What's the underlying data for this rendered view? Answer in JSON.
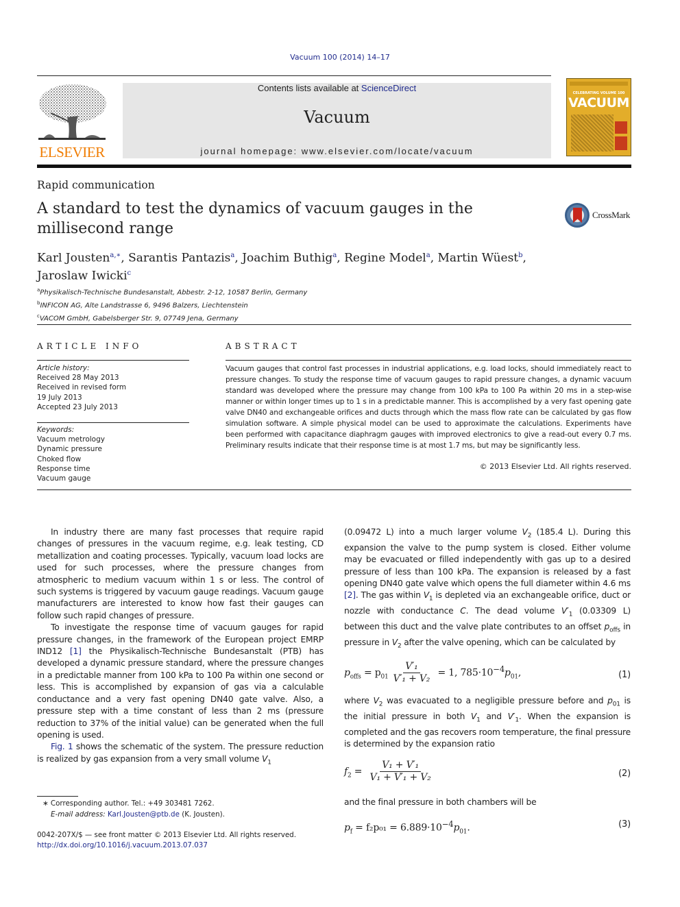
{
  "header": {
    "citation": "Vacuum 100 (2014) 14–17",
    "contents_prefix": "Contents lists available at ",
    "contents_link": "ScienceDirect",
    "journal_name": "Vacuum",
    "homepage_label": "journal homepage: ",
    "homepage_url": "www.elsevier.com/locate/vacuum",
    "publisher_logo": "ELSEVIER",
    "cover": {
      "banner": "CELEBRATING VOLUME 100",
      "title": "VACUUM"
    },
    "colors": {
      "brand_orange": "#f07c00",
      "link_blue": "#1f2a8c",
      "banner_gray": "#e6e6e6",
      "cover_yellow": "#e3ad2a"
    }
  },
  "article": {
    "type": "Rapid communication",
    "title": "A standard to test the dynamics of vacuum gauges in the millisecond range",
    "crossmark_label": "CrossMark",
    "authors": [
      {
        "name": "Karl Jousten",
        "sup": "a,∗"
      },
      {
        "name": "Sarantis Pantazis",
        "sup": "a"
      },
      {
        "name": "Joachim Buthig",
        "sup": "a"
      },
      {
        "name": "Regine Model",
        "sup": "a"
      },
      {
        "name": "Martin Wüest",
        "sup": "b"
      },
      {
        "name": "Jaroslaw Iwicki",
        "sup": "c"
      }
    ],
    "affiliations": [
      {
        "key": "a",
        "text": "Physikalisch-Technische Bundesanstalt, Abbestr. 2-12, 10587 Berlin, Germany"
      },
      {
        "key": "b",
        "text": "INFICON AG, Alte Landstrasse 6, 9496 Balzers, Liechtenstein"
      },
      {
        "key": "c",
        "text": "VACOM GmbH, Gabelsberger Str. 9, 07749 Jena, Germany"
      }
    ]
  },
  "article_info": {
    "heading": "ARTICLE INFO",
    "history_label": "Article history:",
    "history": [
      "Received 28 May 2013",
      "Received in revised form",
      "19 July 2013",
      "Accepted 23 July 2013"
    ],
    "keywords_label": "Keywords:",
    "keywords": [
      "Vacuum metrology",
      "Dynamic pressure",
      "Choked flow",
      "Response time",
      "Vacuum gauge"
    ]
  },
  "abstract": {
    "heading": "ABSTRACT",
    "text": "Vacuum gauges that control fast processes in industrial applications, e.g. load locks, should immediately react to pressure changes. To study the response time of vacuum gauges to rapid pressure changes, a dynamic vacuum standard was developed where the pressure may change from 100 kPa to 100 Pa within 20 ms in a step-wise manner or within longer times up to 1 s in a predictable manner. This is accomplished by a very fast opening gate valve DN40 and exchangeable orifices and ducts through which the mass flow rate can be calculated by gas flow simulation software. A simple physical model can be used to approximate the calculations. Experiments have been performed with capacitance diaphragm gauges with improved electronics to give a read-out every 0.7 ms. Preliminary results indicate that their response time is at most 1.7 ms, but may be significantly less.",
    "copyright": "© 2013 Elsevier Ltd. All rights reserved."
  },
  "body": {
    "left": {
      "p1": "In industry there are many fast processes that require rapid changes of pressures in the vacuum regime, e.g. leak testing, CD metallization and coating processes. Typically, vacuum load locks are used for such processes, where the pressure changes from atmospheric to medium vacuum within 1 s or less. The control of such systems is triggered by vacuum gauge readings. Vacuum gauge manufacturers are interested to know how fast their gauges can follow such rapid changes of pressure.",
      "p2_a": "To investigate the response time of vacuum gauges for rapid pressure changes, in the framework of the European project EMRP IND12 ",
      "p2_ref": "[1]",
      "p2_b": " the Physikalisch-Technische Bundesanstalt (PTB) has developed a dynamic pressure standard, where the pressure changes in a predictable manner from 100 kPa to 100 Pa within one second or less. This is accomplished by expansion of gas via a calculable conductance and a very fast opening DN40 gate valve. Also, a pressure step with a time constant of less than 2 ms (pressure reduction to 37% of the initial value) can be generated when the full opening is used.",
      "p3_ref": "Fig. 1",
      "p3_text": " shows the schematic of the system. The pressure reduction is realized by gas expansion from a very small volume "
    },
    "right": {
      "p1_a": "(0.09472 L) into a much larger volume ",
      "p1_b": " (185.4 L). During this expansion the valve to the pump system is closed. Either volume may be evacuated or filled independently with gas up to a desired pressure of less than 100 kPa. The expansion is released by a fast opening DN40 gate valve which opens the full diameter within 4.6 ms ",
      "p1_ref": "[2]",
      "p1_c": ". The gas within ",
      "p1_d": " is depleted via an exchangeable orifice, duct or nozzle with conductance ",
      "p1_e": ". The dead volume ",
      "p1_f": " (0.03309 L) between this duct and the valve plate contributes to an offset ",
      "p1_g": " in pressure in ",
      "p1_h": " after the valve opening, which can be calculated by",
      "eq1": {
        "lhs": "p",
        "lhs_sub": "offs",
        "rhs_pre": "= p",
        "rhs_pre_sub": "01",
        "num": "V′₁",
        "den": "V′₁ + V₂",
        "result": "= 1, 785·10",
        "exp": "−4",
        "tail": "p",
        "tail_sub": "01",
        "tail_end": ",",
        "number": "(1)"
      },
      "p2_a": "where ",
      "p2_b": " was evacuated to a negligible pressure before and ",
      "p2_c": " is the initial pressure in both ",
      "p2_d": " and ",
      "p2_e": ". When the expansion is completed and the gas recovers room temperature, the final pressure is determined by the expansion ratio",
      "eq2": {
        "lhs": "f",
        "lhs_sub": "2",
        "num": "V₁ + V′₁",
        "den": "V₁ + V′₁ + V₂",
        "number": "(2)"
      },
      "p3": "and the final pressure in both chambers will be",
      "eq3": {
        "lhs": "p",
        "lhs_sub": "f",
        "mid": "= f₂p₀₁ = 6.889·10",
        "exp": "−4",
        "tail": "p",
        "tail_sub": "01",
        "tail_end": ".",
        "number": "(3)"
      }
    },
    "symbols": {
      "V1": "V",
      "V1_sub": "1",
      "V2": "V",
      "V2_sub": "2",
      "C": "C",
      "V1p": "V′",
      "p": "p",
      "offs": "offs",
      "p01_sub": "01"
    }
  },
  "footnotes": {
    "corresponding": "∗  Corresponding author. Tel.: +49 303481 7262.",
    "email_label": "E-mail address: ",
    "email": "Karl.Jousten@ptb.de",
    "email_suffix": " (K. Jousten).",
    "issn": "0042-207X/$ — see front matter © 2013 Elsevier Ltd. All rights reserved.",
    "doi": "http://dx.doi.org/10.1016/j.vacuum.2013.07.037"
  }
}
